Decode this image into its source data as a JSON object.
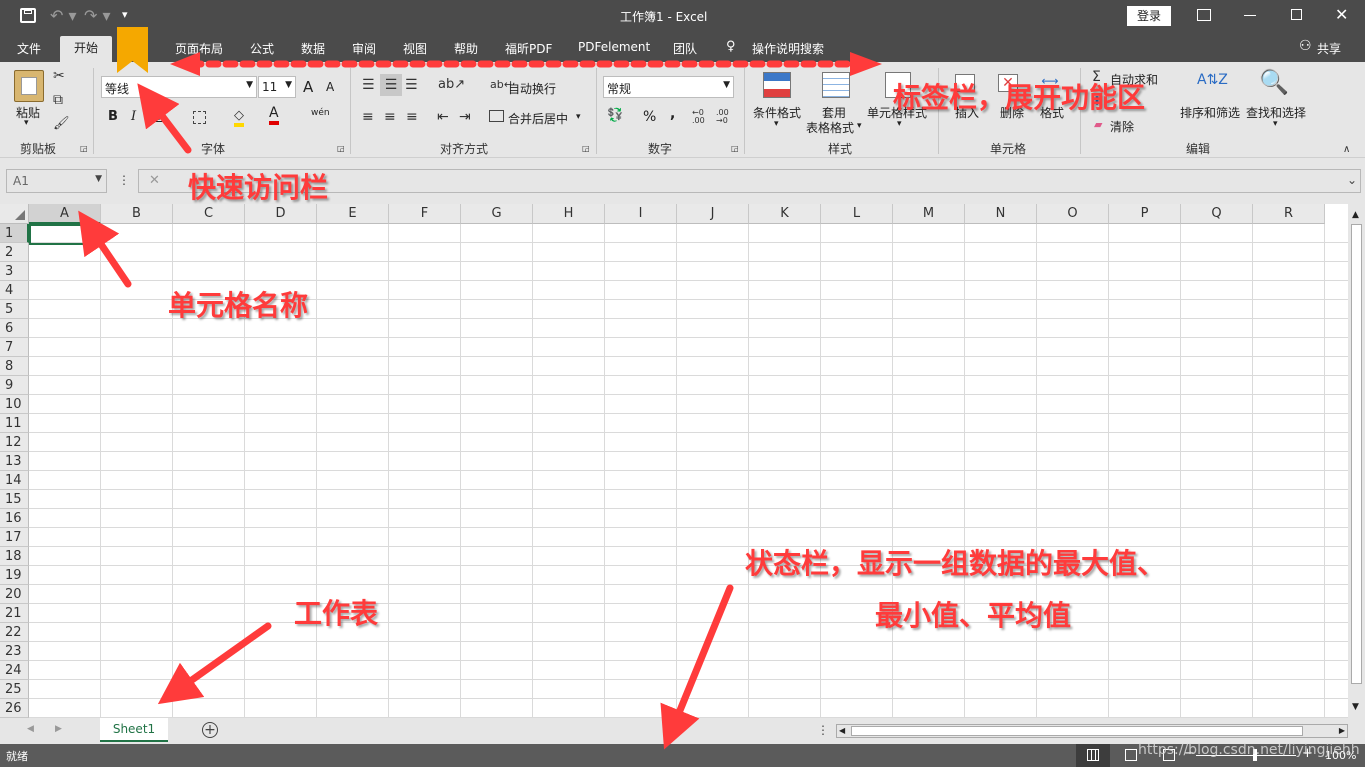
{
  "window": {
    "title": "工作簿1  -  Excel",
    "login_label": "登录"
  },
  "tabs": [
    {
      "label": "文件"
    },
    {
      "label": "开始"
    },
    {
      "label": "页面布局"
    },
    {
      "label": "公式"
    },
    {
      "label": "数据"
    },
    {
      "label": "审阅"
    },
    {
      "label": "视图"
    },
    {
      "label": "帮助"
    },
    {
      "label": "福昕PDF"
    },
    {
      "label": "PDFelement"
    },
    {
      "label": "团队"
    },
    {
      "label": "操作说明搜索"
    }
  ],
  "share_label": "共享",
  "ribbon": {
    "clipboard": {
      "paste": "粘贴",
      "label": "剪贴板"
    },
    "font": {
      "name": "等线",
      "size": "11",
      "label": "字体",
      "bold": "B",
      "italic": "I",
      "underline": "U",
      "grow": "A",
      "shrink": "A",
      "font_color": "A",
      "phonetic": "wén"
    },
    "alignment": {
      "wrap": "自动换行",
      "merge": "合并后居中",
      "label": "对齐方式"
    },
    "number": {
      "format": "常规",
      "percent": "%",
      "comma": ",",
      "label": "数字"
    },
    "styles": {
      "conditional": "条件格式",
      "table_format_1": "套用",
      "table_format_2": "表格格式",
      "cell_styles": "单元格样式",
      "label": "样式"
    },
    "cells": {
      "insert": "插入",
      "delete": "删除",
      "format": "格式",
      "label": "单元格"
    },
    "editing": {
      "autosum": "自动求和",
      "clear": "清除",
      "sort": "排序和筛选",
      "find": "查找和选择",
      "label": "编辑"
    }
  },
  "namebox": {
    "value": "A1"
  },
  "formula": {
    "cancel": "✕"
  },
  "columns": [
    "A",
    "B",
    "C",
    "D",
    "E",
    "F",
    "G",
    "H",
    "I",
    "J",
    "K",
    "L",
    "M",
    "N",
    "O",
    "P",
    "Q",
    "R"
  ],
  "rows": [
    "1",
    "2",
    "3",
    "4",
    "5",
    "6",
    "7",
    "8",
    "9",
    "10",
    "11",
    "12",
    "13",
    "14",
    "15",
    "16",
    "17",
    "18",
    "19",
    "20",
    "21",
    "22",
    "23",
    "24",
    "25",
    "26"
  ],
  "sheet": {
    "tab": "Sheet1",
    "add": "+"
  },
  "status": {
    "ready": "就绪",
    "zoom": "100%",
    "watermark": "https://blog.csdn.net/liyingjiehh"
  },
  "annotations": {
    "ribbon": "标签栏，展开功能区",
    "quick_access": "快速访问栏",
    "cell_name": "单元格名称",
    "worksheet": "工作表",
    "status_1": "状态栏，显示一组数据的最大值、",
    "status_2": "最小值、平均值"
  },
  "colors": {
    "accent": "#217346",
    "annotation": "#ff3b3b",
    "bookmark": "#f5a800"
  }
}
